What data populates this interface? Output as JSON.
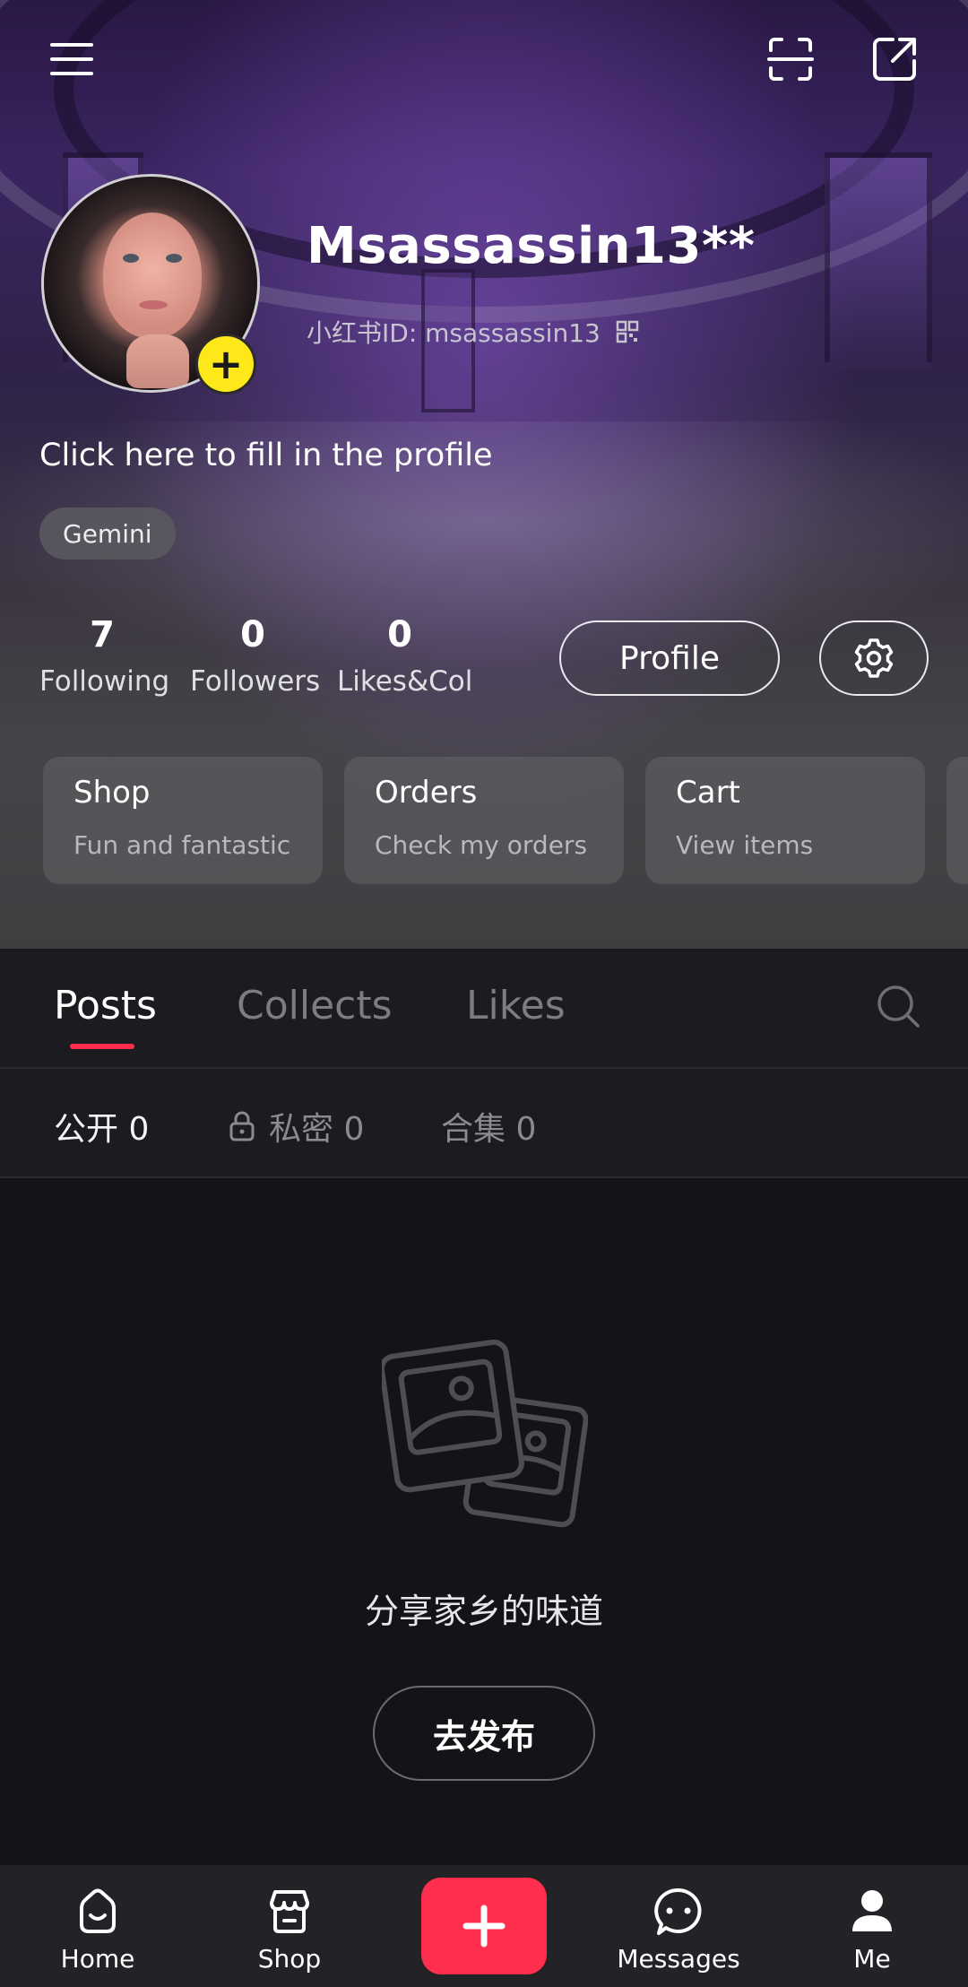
{
  "profile": {
    "username": "Msassassin13**",
    "user_id_label": "小红书ID: msassassin13",
    "bio": "Click here to fill in the profile",
    "tag": "Gemini",
    "avatar_add": "+"
  },
  "stats": [
    {
      "value": "7",
      "label": "Following"
    },
    {
      "value": "0",
      "label": "Followers"
    },
    {
      "value": "0",
      "label": "Likes&Col"
    }
  ],
  "buttons": {
    "profile_label": "Profile"
  },
  "cards": [
    {
      "title": "Shop",
      "subtitle": "Fun and fantastic"
    },
    {
      "title": "Orders",
      "subtitle": "Check my orders"
    },
    {
      "title": "Cart",
      "subtitle": "View items"
    }
  ],
  "tabs": [
    {
      "label": "Posts",
      "active": true
    },
    {
      "label": "Collects",
      "active": false
    },
    {
      "label": "Likes",
      "active": false
    }
  ],
  "subtabs": [
    {
      "label": "公开 0",
      "active": true
    },
    {
      "label": "私密 0",
      "active": false
    },
    {
      "label": "合集 0",
      "active": false
    }
  ],
  "empty_state": {
    "message": "分享家乡的味道",
    "action_label": "去发布"
  },
  "bottom_nav": [
    {
      "label": "Home",
      "icon": "home-icon"
    },
    {
      "label": "Shop",
      "icon": "shop-icon"
    },
    {
      "label": "",
      "icon": "add-icon"
    },
    {
      "label": "Messages",
      "icon": "messages-icon"
    },
    {
      "label": "Me",
      "icon": "person-icon"
    }
  ],
  "colors": {
    "accent": "#ff2e4d",
    "avatar_add": "#ffe81a",
    "background": "#141317"
  }
}
